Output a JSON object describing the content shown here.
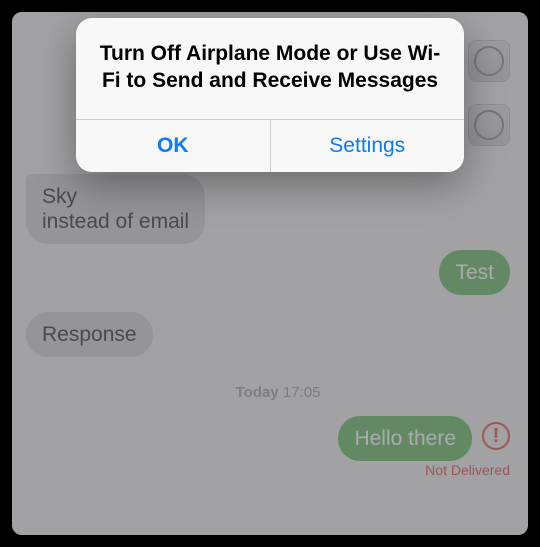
{
  "chat": {
    "incoming_truncated": "Sky",
    "incoming_line2": "instead of email",
    "outgoing_test": "Test",
    "incoming_response": "Response",
    "outgoing_hello": "Hello there"
  },
  "timestamp": {
    "day": "Today",
    "time": "17:05"
  },
  "error": {
    "mark": "!",
    "label": "Not Delivered"
  },
  "alert": {
    "message": "Turn Off Airplane Mode or Use Wi-Fi to Send and Receive Messages",
    "ok": "OK",
    "settings": "Settings"
  },
  "icons": {
    "compass": "safari-compass-icon"
  }
}
